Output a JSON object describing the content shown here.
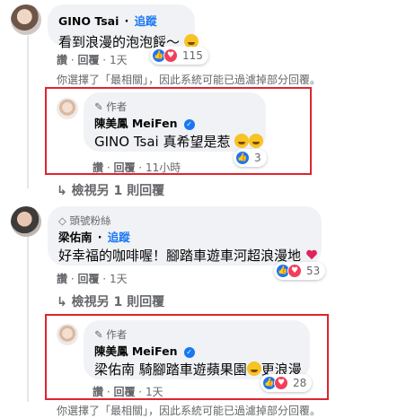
{
  "comments": {
    "c1": {
      "name": "GINO Tsai",
      "follow": "追蹤",
      "text": "看到浪漫的泡泡餒～",
      "reaction_count": "115",
      "actions": {
        "like": "讚",
        "reply": "回覆",
        "time": "1天"
      }
    },
    "c2": {
      "badge": "作者",
      "name": "陳美鳳 MeiFen",
      "text": "GINO Tsai 真希望是惹",
      "reaction_count": "3",
      "actions": {
        "like": "讚",
        "reply": "回覆",
        "time": "11小時"
      }
    },
    "c3": {
      "badge": "頭號粉絲",
      "name": "梁佑南",
      "follow": "追蹤",
      "text": "好幸福的咖啡喔！腳踏車遊車河超浪漫地",
      "reaction_count": "53",
      "actions": {
        "like": "讚",
        "reply": "回覆",
        "time": "1天"
      }
    },
    "c4": {
      "badge": "作者",
      "name": "陳美鳳 MeiFen",
      "text": "梁佑南 騎腳踏車遊蘋果園",
      "text_suffix": "更浪漫",
      "reaction_count": "28",
      "actions": {
        "like": "讚",
        "reply": "回覆",
        "time": "1天"
      }
    }
  },
  "notices": {
    "top": "你選擇了「最相關」，因此系統可能已過濾掉部分回覆。",
    "bottom": "你選擇了「最相關」，因此系統可能已過濾掉部分回覆。"
  },
  "more_replies": {
    "first": "檢視另 1 則回覆",
    "second": "檢視另 1 則回覆"
  },
  "colors": {
    "highlight": "#e0242d",
    "link": "#1877f2",
    "bubble": "#f0f2f5"
  }
}
